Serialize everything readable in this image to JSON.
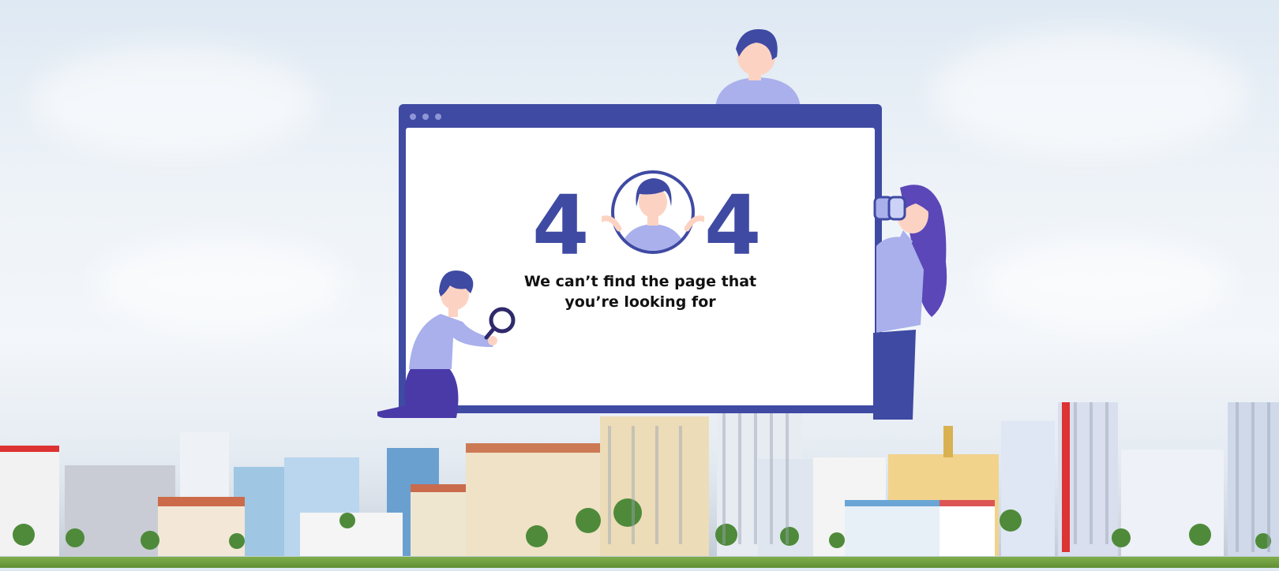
{
  "error": {
    "digit_left": "4",
    "digit_right": "4",
    "message_line1": "We can’t find the page that",
    "message_line2": "you’re looking for"
  },
  "colors": {
    "brand": "#3f4aa3",
    "accent_light": "#a9b0ec",
    "background": "#eef3f8"
  },
  "icons": {
    "person_top": "person-peeking-icon",
    "person_search": "person-magnifier-icon",
    "person_binoculars": "person-binoculars-icon",
    "person_circle": "person-shrug-icon"
  }
}
